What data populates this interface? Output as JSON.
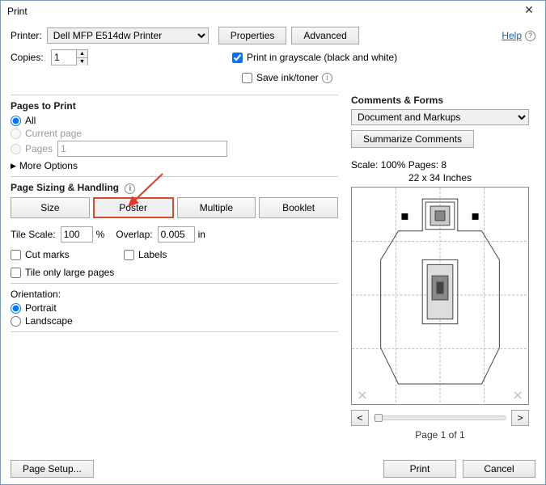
{
  "window": {
    "title": "Print"
  },
  "top": {
    "printer_label": "Printer:",
    "printer_value": "Dell MFP E514dw Printer",
    "properties": "Properties",
    "advanced": "Advanced",
    "help": "Help",
    "copies_label": "Copies:",
    "copies_value": "1",
    "grayscale_label": "Print in grayscale (black and white)",
    "saveink_label": "Save ink/toner"
  },
  "pages": {
    "title": "Pages to Print",
    "all": "All",
    "current": "Current page",
    "pages": "Pages",
    "pages_value": "1",
    "more": "More Options"
  },
  "sizing": {
    "title": "Page Sizing & Handling",
    "size": "Size",
    "poster": "Poster",
    "multiple": "Multiple",
    "booklet": "Booklet",
    "tilescale_label": "Tile Scale:",
    "tilescale_value": "100",
    "tilescale_pct": "%",
    "overlap_label": "Overlap:",
    "overlap_value": "0.005",
    "overlap_unit": "in",
    "cutmarks": "Cut marks",
    "labels": "Labels",
    "tileonly": "Tile only large pages"
  },
  "orientation": {
    "title": "Orientation:",
    "portrait": "Portrait",
    "landscape": "Landscape"
  },
  "comments": {
    "title": "Comments & Forms",
    "select_value": "Document and Markups",
    "summarize": "Summarize Comments"
  },
  "preview": {
    "scale_pages": "Scale: 100% Pages: 8",
    "dimensions": "22 x 34 Inches",
    "page_of": "Page 1 of 1",
    "prev": "<",
    "next": ">"
  },
  "footer": {
    "pagesetup": "Page Setup...",
    "print": "Print",
    "cancel": "Cancel"
  }
}
